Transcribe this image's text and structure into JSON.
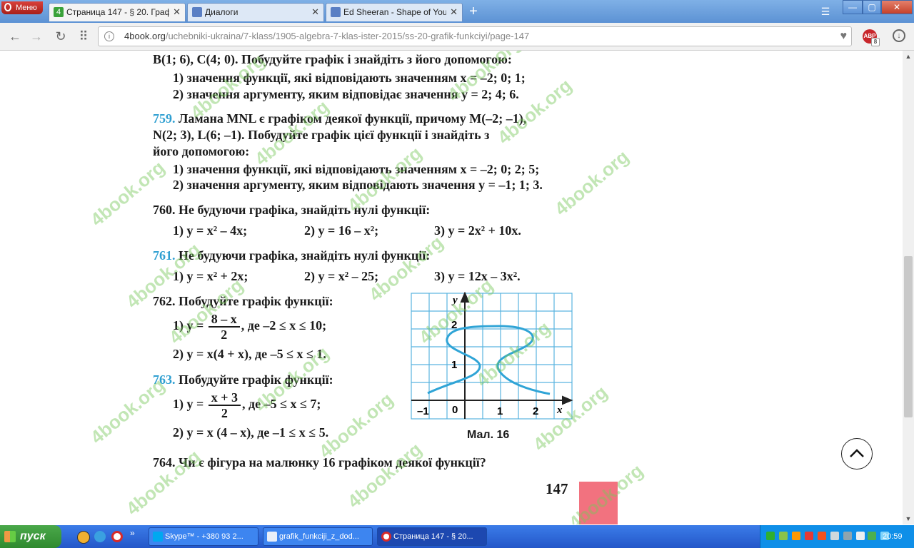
{
  "browser": {
    "menu_label": "Меню",
    "tabs": [
      {
        "label": "Страница 147 - § 20. Графі",
        "close": "✕",
        "icon_text": "4",
        "active": true
      },
      {
        "label": "Диалоги",
        "close": "✕",
        "icon_text": "",
        "active": false
      },
      {
        "label": "Ed Sheeran - Shape of You",
        "close": "✕",
        "icon_text": "",
        "active": false
      }
    ],
    "new_tab": "+",
    "tabs_menu": "☰",
    "window_controls": {
      "minimize": "—",
      "maximize": "▢",
      "close": "✕"
    },
    "nav": {
      "back": "←",
      "forward": "→",
      "reload": "↻",
      "grid": "⠿"
    },
    "url_host": "4book.org",
    "url_path": "/uchebniki-ukraina/7-klass/1905-algebra-7-klas-ister-2015/ss-20-grafik-funkciyi/page-147",
    "security_icon": "i",
    "bookmark": "♥",
    "abp_label": "ABP",
    "abp_count": "8",
    "download": "↓"
  },
  "page": {
    "lines": [
      "B(1; 6), C(4; 0). Побудуйте графік і знайдіть з його допомогою:",
      "1) значення функції, які відповідають значенням x = –2; 0; 1;",
      "2) значення аргументу, яким відповідає значення y = 2; 4; 6."
    ],
    "p759": {
      "num": "759.",
      "l1": " Ламана MNL є графіком деякої функції, причому M(–2; –1),",
      "l2": "N(2; 3), L(6; –1). Побудуйте графік цієї функції і знайдіть з",
      "l3": "його допомогою:",
      "l4": "1) значення функції, які відповідають значенням x = –2; 0; 2; 5;",
      "l5": "2) значення аргументу, яким відповідають значення y = –1; 1; 3."
    },
    "p760": {
      "num": "760.",
      "text": " Не будуючи графіка, знайдіть нулі функції:",
      "a": "1) y = x² – 4x;",
      "b": "2) y = 16 – x²;",
      "c": "3) y = 2x² + 10x."
    },
    "p761": {
      "num": "761.",
      "text": " Не будуючи графіка, знайдіть нулі функції:",
      "a": "1) y = x² + 2x;",
      "b": "2) y = x² – 25;",
      "c": "3) y = 12x – 3x²."
    },
    "p762": {
      "num": "762.",
      "text": " Побудуйте графік функції:",
      "a_pre": "1) y =",
      "a_num": "8 – x",
      "a_den": "2",
      "a_post": ", де –2 ≤ x ≤ 10;",
      "b": "2) y = x(4 + x), де –5 ≤ x ≤ 1."
    },
    "p763": {
      "num": "763.",
      "text": " Побудуйте графік функції:",
      "a_pre": "1) y =",
      "a_num": "x + 3",
      "a_den": "2",
      "a_post": ", де –5 ≤ x ≤ 7;",
      "b": "2) y = x (4 – x), де –1 ≤ x ≤ 5."
    },
    "p764": {
      "num": "764.",
      "text": " Чи є фігура на малюнку 16 графіком деякої функції?"
    },
    "page_number": "147",
    "watermark": "4book.org",
    "figure": {
      "caption": "Мал. 16",
      "x_label": "x",
      "y_label": "y",
      "x_ticks": [
        "–1",
        "0",
        "1",
        "2"
      ],
      "y_ticks": [
        "1",
        "2"
      ],
      "grid_color": "#5ab4e0",
      "curve_color": "#2fa4d6"
    }
  },
  "taskbar": {
    "start_label": "пуск",
    "tasks": [
      {
        "label": "Skype™ - +380 93 2...",
        "active": false
      },
      {
        "label": "grafik_funkciji_z_dod...",
        "active": false
      },
      {
        "label": "Страница 147 - § 20...",
        "active": true
      }
    ],
    "chevron": "»",
    "clock": "20:59"
  },
  "scroll_top_icon": "chevron-up",
  "colors": {
    "problem_number": "#2f9fd1",
    "watermark": "#78c85a",
    "page_corner": "#f2727f"
  }
}
